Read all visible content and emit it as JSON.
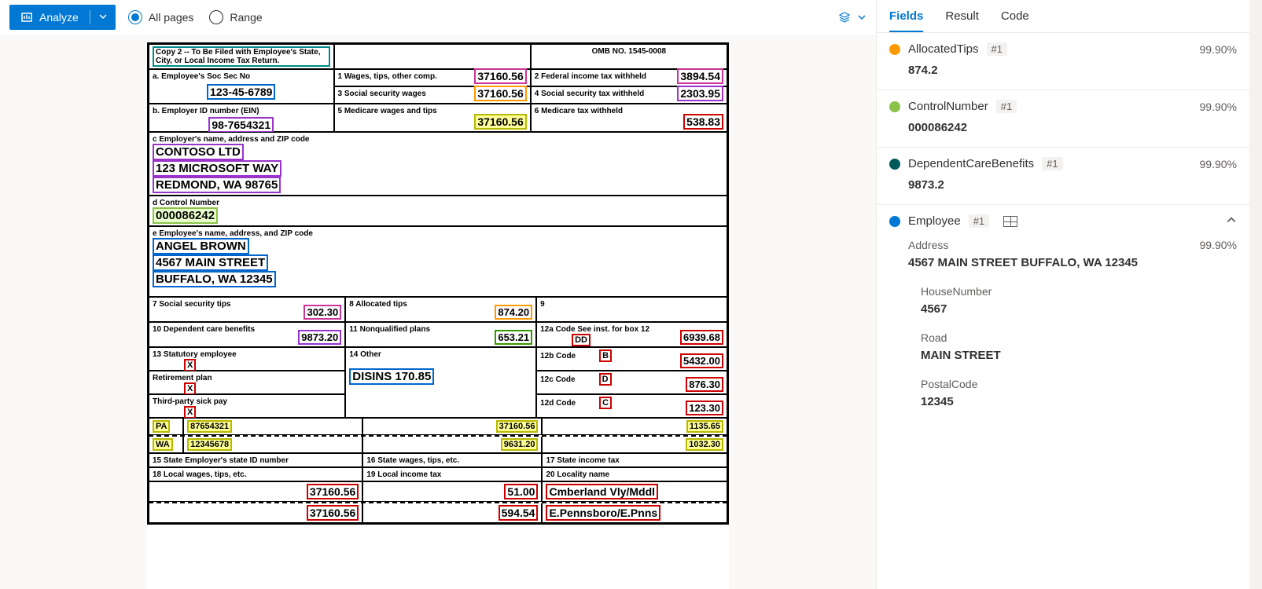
{
  "toolbar": {
    "analyze": "Analyze",
    "all_pages": "All pages",
    "range": "Range"
  },
  "tabs": {
    "fields": "Fields",
    "result": "Result",
    "code": "Code"
  },
  "fields": {
    "allocated_tips": {
      "name": "AllocatedTips",
      "badge": "#1",
      "conf": "99.90%",
      "value": "874.2"
    },
    "control_number": {
      "name": "ControlNumber",
      "badge": "#1",
      "conf": "99.90%",
      "value": "000086242"
    },
    "dependent_care": {
      "name": "DependentCareBenefits",
      "badge": "#1",
      "conf": "99.90%",
      "value": "9873.2"
    },
    "employee": {
      "name": "Employee",
      "badge": "#1",
      "address": {
        "label": "Address",
        "conf": "99.90%",
        "value": "4567 MAIN STREET BUFFALO, WA 12345"
      },
      "house": {
        "label": "HouseNumber",
        "value": "4567"
      },
      "road": {
        "label": "Road",
        "value": "MAIN STREET"
      },
      "postal": {
        "label": "PostalCode",
        "value": "12345"
      }
    }
  },
  "w2": {
    "copy2": "Copy 2 -- To Be Filed with Employee's State, City, or Local Income Tax Return.",
    "omb": "OMB NO. 1545-0008",
    "a_lbl": "a. Employee's Soc Sec No",
    "a_val": "123-45-6789",
    "b_lbl": "b. Employer ID number (EIN)",
    "b_val": "98-7654321",
    "box1_lbl": "1 Wages, tips, other comp.",
    "box1_val": "37160.56",
    "box2_lbl": "2 Federal income tax withheld",
    "box2_val": "3894.54",
    "box3_lbl": "3 Social security wages",
    "box3_val": "37160.56",
    "box4_lbl": "4 Social security tax withheld",
    "box4_val": "2303.95",
    "box5_lbl": "5 Medicare wages and tips",
    "box5_val": "37160.56",
    "box6_lbl": "6 Medicare tax withheld",
    "box6_val": "538.83",
    "c_lbl": "c Employer's name, address and ZIP code",
    "c_line1": "CONTOSO LTD",
    "c_line2": "123 MICROSOFT WAY",
    "c_line3": "REDMOND, WA 98765",
    "d_lbl": "d Control Number",
    "d_val": "000086242",
    "e_lbl": "e Employee's name, address, and ZIP code",
    "e_line1": "ANGEL BROWN",
    "e_line2": "4567 MAIN STREET",
    "e_line3": "BUFFALO, WA 12345",
    "box7_lbl": "7 Social security tips",
    "box7_val": "302.30",
    "box8_lbl": "8 Allocated tips",
    "box8_val": "874.20",
    "box9_lbl": "9",
    "box10_lbl": "10 Dependent care benefits",
    "box10_val": "9873.20",
    "box11_lbl": "11 Nonqualified plans",
    "box11_val": "653.21",
    "box12a_lbl": "12a Code See inst. for box 12",
    "box12a_code": "DD",
    "box12a_val": "6939.68",
    "box12b_lbl": "12b Code",
    "box12b_code": "B",
    "box12b_val": "5432.00",
    "box12c_lbl": "12c Code",
    "box12c_code": "D",
    "box12c_val": "876.30",
    "box12d_lbl": "12d Code",
    "box12d_code": "C",
    "box12d_val": "123.30",
    "box13_lbl": "13 Statutory employee",
    "box13_x": "X",
    "retirement_lbl": "Retirement plan",
    "retirement_x": "X",
    "sickpay_lbl": "Third-party sick pay",
    "sickpay_x": "X",
    "box14_lbl": "14 Other",
    "box14_val": "DISINS    170.85",
    "state1": "PA",
    "state1_id": "87654321",
    "state1_wages": "37160.56",
    "state1_tax": "1135.65",
    "state2": "WA",
    "state2_id": "12345678",
    "state2_wages": "9631.20",
    "state2_tax": "1032.30",
    "box15_lbl": "15 State Employer's state ID number",
    "box16_lbl": "16 State wages, tips, etc.",
    "box17_lbl": "17 State income tax",
    "box18_lbl": "18 Local wages, tips, etc.",
    "box19_lbl": "19 Local income tax",
    "box20_lbl": "20 Locality name",
    "local1_wages": "37160.56",
    "local1_tax": "51.00",
    "local1_name": "Cmberland Vly/Mddl",
    "local2_wages": "37160.56",
    "local2_tax": "594.54",
    "local2_name": "E.Pennsboro/E.Pnns"
  }
}
